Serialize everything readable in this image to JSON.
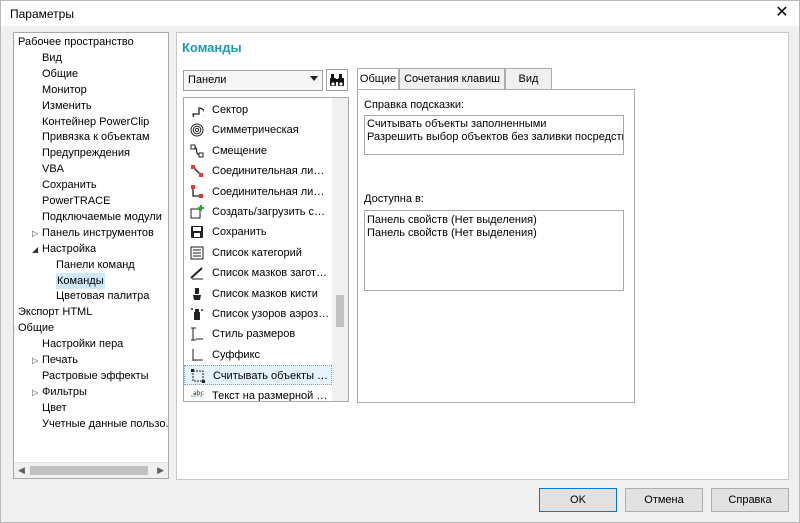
{
  "window": {
    "title": "Параметры",
    "close_glyph": "✕"
  },
  "tree": {
    "items": [
      {
        "label": "Рабочее пространство",
        "level": 0,
        "expander": "open"
      },
      {
        "label": "Вид",
        "level": 1
      },
      {
        "label": "Общие",
        "level": 1
      },
      {
        "label": "Монитор",
        "level": 1
      },
      {
        "label": "Изменить",
        "level": 1
      },
      {
        "label": "Контейнер PowerClip",
        "level": 1
      },
      {
        "label": "Привязка к объектам",
        "level": 1
      },
      {
        "label": "Предупреждения",
        "level": 1
      },
      {
        "label": "VBA",
        "level": 1
      },
      {
        "label": "Сохранить",
        "level": 1
      },
      {
        "label": "PowerTRACE",
        "level": 1
      },
      {
        "label": "Подключаемые модули",
        "level": 1
      },
      {
        "label": "Панель инструментов",
        "level": 1,
        "expander": "closed"
      },
      {
        "label": "Настройка",
        "level": 1,
        "expander": "open"
      },
      {
        "label": "Панели команд",
        "level": 2
      },
      {
        "label": "Команды",
        "level": 2,
        "selected": true
      },
      {
        "label": "Цветовая палитра",
        "level": 2
      },
      {
        "label": "Экспорт HTML",
        "level": 0
      },
      {
        "label": "Общие",
        "level": 0,
        "expander": "open"
      },
      {
        "label": "Настройки пера",
        "level": 1
      },
      {
        "label": "Печать",
        "level": 1,
        "expander": "closed"
      },
      {
        "label": "Растровые эффекты",
        "level": 1
      },
      {
        "label": "Фильтры",
        "level": 1,
        "expander": "closed"
      },
      {
        "label": "Цвет",
        "level": 1
      },
      {
        "label": "Учетные данные пользо...",
        "level": 1
      }
    ]
  },
  "main": {
    "heading": "Команды",
    "combo_value": "Панели",
    "commands": [
      {
        "label": "Сектор",
        "icon": "sector-icon"
      },
      {
        "label": "Симметрическая",
        "icon": "spiral-icon"
      },
      {
        "label": "Смещение",
        "icon": "offset-icon"
      },
      {
        "label": "Соединительная линия",
        "icon": "connector-line-icon"
      },
      {
        "label": "Соединительная лини...",
        "icon": "right-angle-connector-icon"
      },
      {
        "label": "Создать/загрузить сли...",
        "icon": "create-merge-icon"
      },
      {
        "label": "Сохранить",
        "icon": "save-icon"
      },
      {
        "label": "Список категорий",
        "icon": "category-list-icon"
      },
      {
        "label": "Список мазков заготов...",
        "icon": "preset-stroke-icon"
      },
      {
        "label": "Список мазков кисти",
        "icon": "brush-stroke-icon"
      },
      {
        "label": "Список узоров аэрозо...",
        "icon": "spray-icon"
      },
      {
        "label": "Стиль размеров",
        "icon": "dimension-style-icon"
      },
      {
        "label": "Суффикс",
        "icon": "suffix-icon"
      },
      {
        "label": "Считывать объекты за...",
        "icon": "treat-filled-icon",
        "selected": true
      },
      {
        "label": "Текст на размерной ли...",
        "icon": "dimension-text-icon"
      }
    ],
    "tabs": [
      {
        "label": "Общие",
        "active": true
      },
      {
        "label": "Сочетания клавиш"
      },
      {
        "label": "Вид"
      }
    ],
    "tooltip_label": "Справка подсказки:",
    "tooltip_lines": [
      "Считывать объекты заполненными",
      "Разрешить выбор объектов без заливки посредство"
    ],
    "available_label": "Доступна в:",
    "available_lines": [
      "Панель свойств (Нет выделения)",
      "Панель свойств (Нет выделения)"
    ]
  },
  "buttons": {
    "ok": "OK",
    "cancel": "Отмена",
    "help": "Справка"
  },
  "colors": {
    "heading": "#1a9bb8",
    "selection": "#cde8ff",
    "default_button_border": "#0078d7"
  }
}
